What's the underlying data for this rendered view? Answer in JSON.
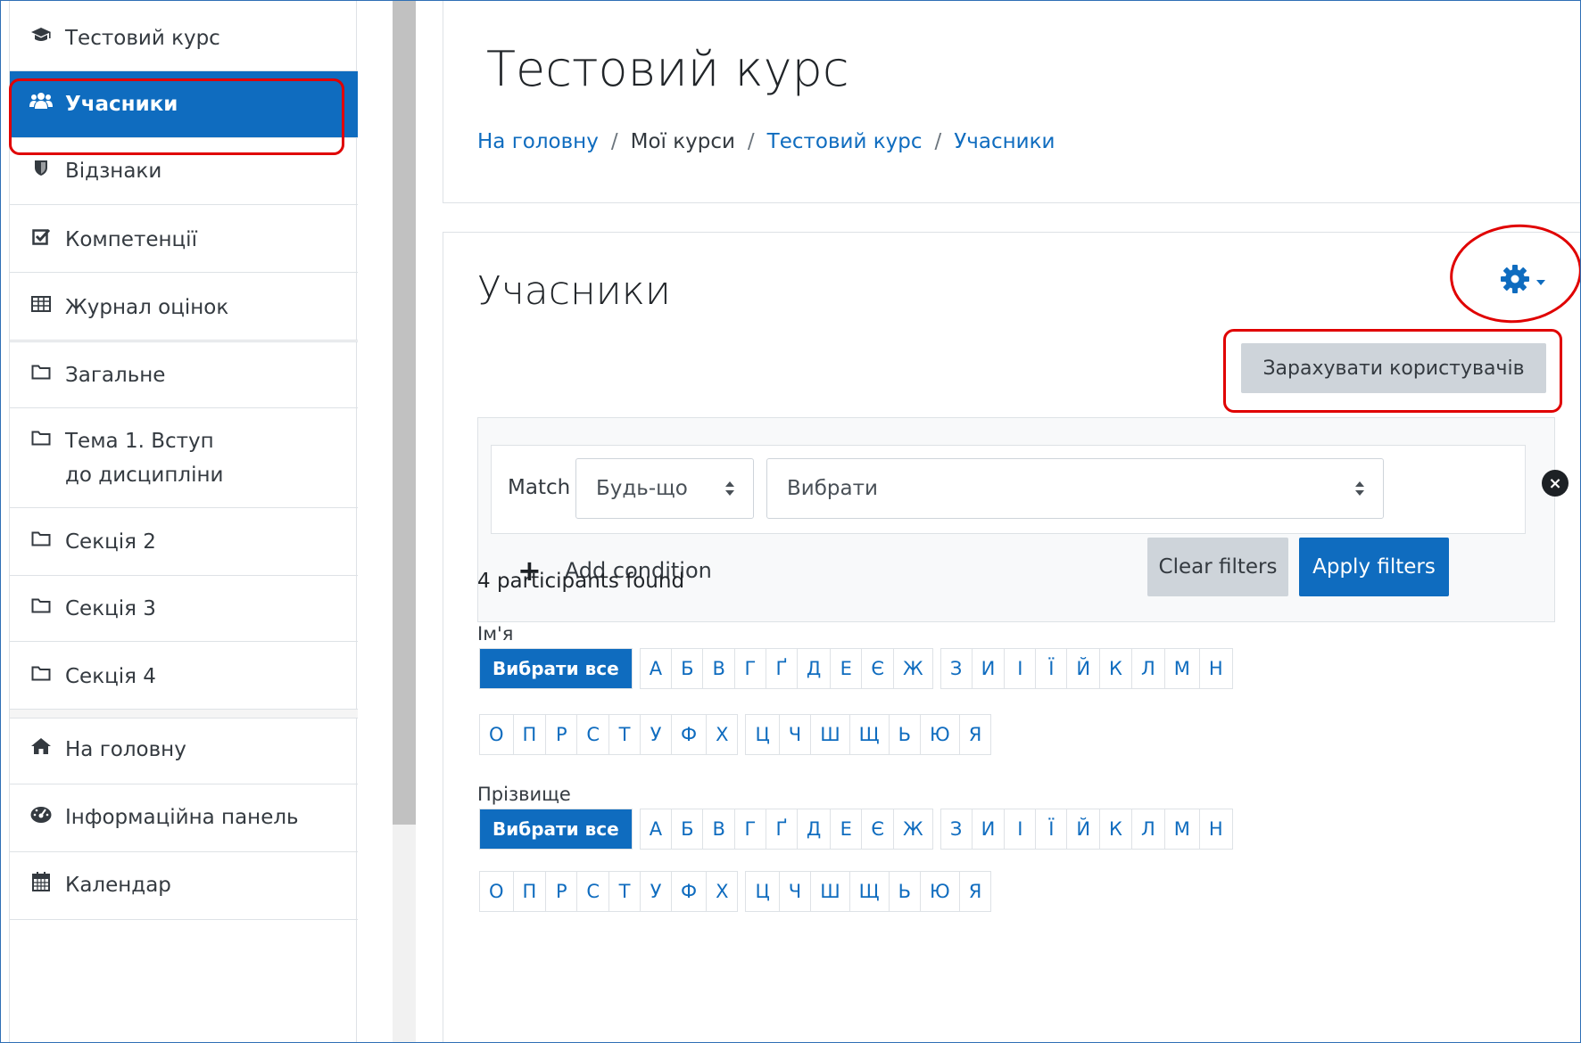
{
  "sidebar": {
    "items": [
      {
        "label": "Тестовий курс",
        "icon": "graduation-cap-icon"
      },
      {
        "label": "Учасники",
        "icon": "users-icon",
        "active": true
      },
      {
        "label": "Відзнаки",
        "icon": "shield-icon"
      },
      {
        "label": "Компетенції",
        "icon": "check-square-icon"
      },
      {
        "label": "Журнал оцінок",
        "icon": "table-icon"
      },
      {
        "label": "Загальне",
        "icon": "folder-icon"
      },
      {
        "label": "Тема 1. Вступ до дисципліни",
        "icon": "folder-icon"
      },
      {
        "label": "Секція 2",
        "icon": "folder-icon"
      },
      {
        "label": "Секція 3",
        "icon": "folder-icon"
      },
      {
        "label": "Секція 4",
        "icon": "folder-icon"
      },
      {
        "label": "На головну",
        "icon": "home-icon"
      },
      {
        "label": "Інформаційна панель",
        "icon": "dashboard-icon"
      },
      {
        "label": "Календар",
        "icon": "calendar-icon"
      }
    ]
  },
  "header": {
    "title": "Тестовий курс",
    "breadcrumb": [
      "На головну",
      "Мої курси",
      "Тестовий курс",
      "Учасники"
    ]
  },
  "main": {
    "title": "Учасники",
    "enrol_button": "Зарахувати користувачів",
    "filter": {
      "match_label": "Match",
      "match_value": "Будь-що",
      "condition_value": "Вибрати",
      "add_condition": "Add condition",
      "clear": "Clear filters",
      "apply": "Apply filters"
    },
    "found_text": "4 participants found",
    "first_name_label": "Ім'я",
    "last_name_label": "Прізвище",
    "select_all": "Вибрати все",
    "letters_row1": [
      "А",
      "Б",
      "В",
      "Г",
      "Ґ",
      "Д",
      "Е",
      "Є",
      "Ж",
      "З",
      "И",
      "І",
      "Ї",
      "Й",
      "К",
      "Л",
      "М",
      "Н"
    ],
    "letters_row2": [
      "О",
      "П",
      "Р",
      "С",
      "Т",
      "У",
      "Ф",
      "Х",
      "Ц",
      "Ч",
      "Ш",
      "Щ",
      "Ь",
      "Ю",
      "Я"
    ]
  },
  "colors": {
    "primary": "#0f6cbf",
    "highlight": "#e00000",
    "secondary_button": "#ced4da"
  }
}
